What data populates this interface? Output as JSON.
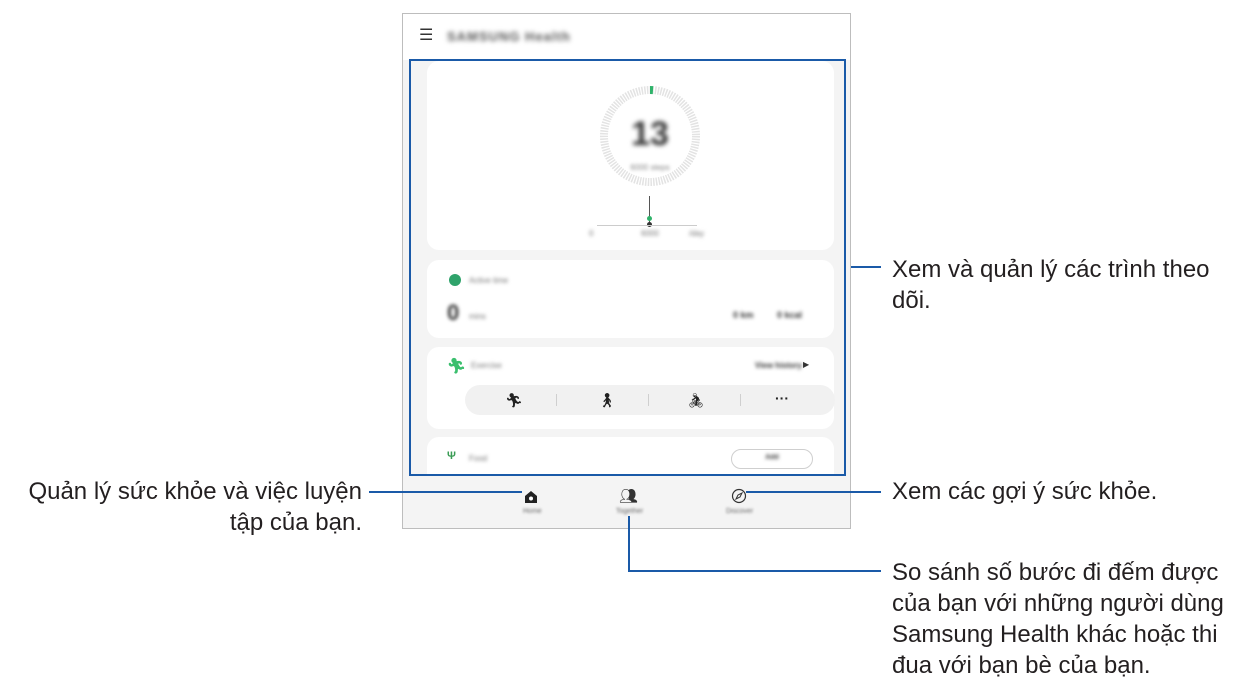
{
  "app": {
    "title": "SAMSUNG Health",
    "menu_icon": "hamburger-menu-icon"
  },
  "tracker_steps": {
    "count": "13",
    "label": "6000 steps",
    "axis_labels": [
      "0",
      "6000",
      "/day"
    ]
  },
  "tracker_active_time": {
    "title": "Active time",
    "value": "0",
    "unit": "mins",
    "right_values": [
      "0 km",
      "0 kcal"
    ]
  },
  "tracker_exercise": {
    "title": "Exercise",
    "link": "View history",
    "activities": [
      "running-icon",
      "walking-icon",
      "cycling-icon",
      "more-icon"
    ],
    "more_label": "···"
  },
  "tracker_food": {
    "title": "Food",
    "button": "Add"
  },
  "nav": {
    "items": [
      {
        "label": "Home",
        "icon": "home-icon"
      },
      {
        "label": "Together",
        "icon": "people-icon"
      },
      {
        "label": "Discover",
        "icon": "compass-icon"
      }
    ]
  },
  "callouts": {
    "trackers": "Xem và quản lý các trình theo dõi.",
    "home": "Quản lý sức khỏe và việc luyện tập của bạn.",
    "discover": "Xem các gợi ý sức khỏe.",
    "together": "So sánh số bước đi đếm được của bạn với những người dùng Samsung Health khác hoặc thi đua với bạn bè của bạn."
  },
  "colors": {
    "accent_line": "#1a5aa8",
    "progress_green": "#2fb36a",
    "active_green": "#2fa36b",
    "exercise_green": "#3bbf6e",
    "food_green": "#3a9c55"
  }
}
